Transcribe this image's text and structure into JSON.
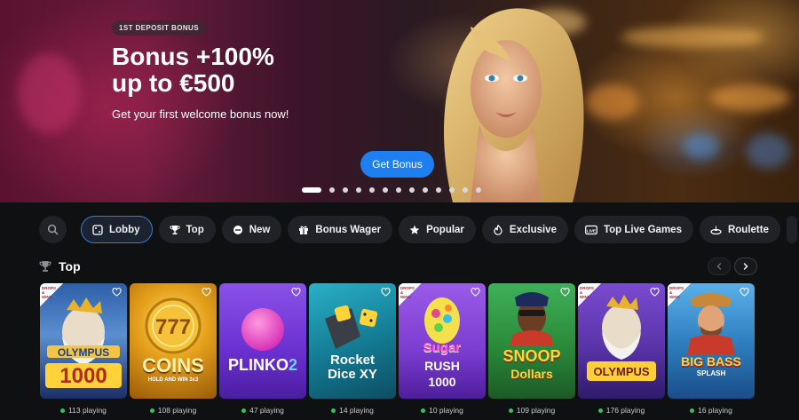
{
  "hero": {
    "badge": "1ST DEPOSIT BONUS",
    "title_line1": "Bonus +100%",
    "title_line2": "up to €500",
    "subtitle": "Get your first welcome bonus now!",
    "cta_label": "Get Bonus",
    "slides_total": 13,
    "active_slide": 1
  },
  "nav": {
    "search_icon": "search-icon",
    "items": [
      {
        "label": "Lobby",
        "icon": "dice-icon",
        "active": true
      },
      {
        "label": "Top",
        "icon": "trophy-icon",
        "active": false
      },
      {
        "label": "New",
        "icon": "new-icon",
        "active": false
      },
      {
        "label": "Bonus Wager",
        "icon": "gift-icon",
        "active": false
      },
      {
        "label": "Popular",
        "icon": "star-icon",
        "active": false
      },
      {
        "label": "Exclusive",
        "icon": "flame-icon",
        "active": false
      },
      {
        "label": "Top Live Games",
        "icon": "live-icon",
        "active": false
      },
      {
        "label": "Roulette",
        "icon": "roulette-icon",
        "active": false
      }
    ]
  },
  "section": {
    "title": "Top",
    "icon": "trophy-icon"
  },
  "games": [
    {
      "title": "Gates of Olympus 1000",
      "art_text": "OLYMPUS",
      "art_num": "1000",
      "playing": "113 playing",
      "drops_wins": true,
      "bg": "#3a6fb0"
    },
    {
      "title": "Coins",
      "art_text": "COINS",
      "art_num": "HOLD AND WIN 3x3",
      "playing": "108 playing",
      "drops_wins": false,
      "bg": "#c8860e"
    },
    {
      "title": "Plinko 2",
      "art_text": "PLINKO",
      "art_num": "2",
      "playing": "47 playing",
      "drops_wins": false,
      "bg": "#7a3cd6"
    },
    {
      "title": "Rocket Dice XY",
      "art_text": "Rocket",
      "art_num": "Dice XY",
      "playing": "14 playing",
      "drops_wins": false,
      "bg": "#1f8fa6"
    },
    {
      "title": "Sugar Rush 1000",
      "art_text": "Sugar",
      "art_num": "RUSH 1000",
      "playing": "10 playing",
      "drops_wins": true,
      "bg": "#8a4fd8"
    },
    {
      "title": "Snoop Dogg Dollars",
      "art_text": "SNOOP",
      "art_num": "Dollars",
      "playing": "109 playing",
      "drops_wins": false,
      "bg": "#2a8a3a"
    },
    {
      "title": "Gates of Olympus",
      "art_text": "OLYMPUS",
      "art_num": "",
      "playing": "176 playing",
      "drops_wins": true,
      "bg": "#6a3fb0"
    },
    {
      "title": "Big Bass Splash",
      "art_text": "BIG BASS",
      "art_num": "SPLASH",
      "playing": "16 playing",
      "drops_wins": true,
      "bg": "#3a8ac8"
    }
  ],
  "drops_label": "DROPS & WINS",
  "colors": {
    "accent": "#1e7ff0",
    "chip_bg": "#202227",
    "page_bg": "#0f1012",
    "live": "#2fc45a"
  }
}
